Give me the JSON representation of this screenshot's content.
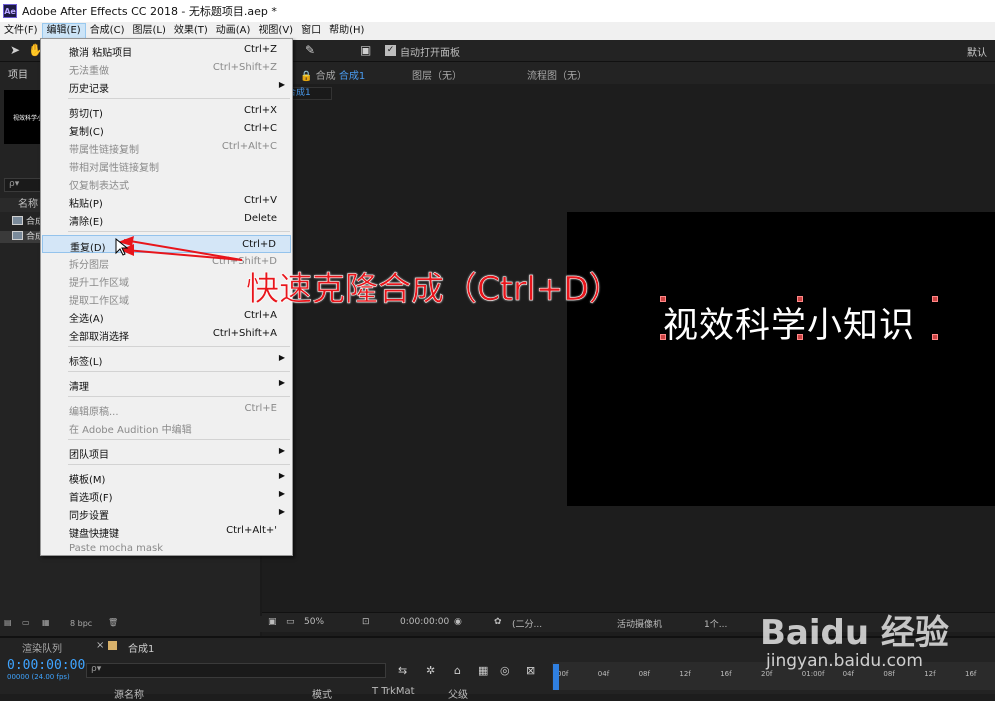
{
  "window": {
    "app_icon": "Ae",
    "title": "Adobe After Effects CC 2018 - 无标题项目.aep *"
  },
  "menubar": [
    "文件(F)",
    "编辑(E)",
    "合成(C)",
    "图层(L)",
    "效果(T)",
    "动画(A)",
    "视图(V)",
    "窗口",
    "帮助(H)"
  ],
  "toolbar": {
    "auto_open_label": "自动打开面板",
    "workspace_label": "默认"
  },
  "project_panel": {
    "tab_label": "项目",
    "thumb_text": "视效科学小知识",
    "search_placeholder": "ρ▾",
    "name_header": "名称",
    "rows": [
      "合成1",
      "合成1"
    ],
    "bpc": "8 bpc"
  },
  "comp_panel": {
    "tab_comp": "合成",
    "tab_comp_name": "合成1",
    "tab_layer": "图层（无）",
    "tab_flow": "流程图（无）",
    "sub_tab": "合成1",
    "canvas_text": "视效科学小知识",
    "zoom": "50%",
    "timecode": "0:00:00:00",
    "resolution": "(二分...",
    "camera": "活动摄像机",
    "views": "1个..."
  },
  "edit_menu": {
    "items": [
      {
        "label": "撤消 粘贴项目",
        "shortcut": "Ctrl+Z",
        "disabled": false
      },
      {
        "label": "无法重做",
        "shortcut": "Ctrl+Shift+Z",
        "disabled": true
      },
      {
        "label": "历史记录",
        "shortcut": "",
        "submenu": true,
        "disabled": false
      },
      {
        "label": "剪切(T)",
        "shortcut": "Ctrl+X",
        "disabled": false
      },
      {
        "label": "复制(C)",
        "shortcut": "Ctrl+C",
        "disabled": false
      },
      {
        "label": "带属性链接复制",
        "shortcut": "Ctrl+Alt+C",
        "disabled": true
      },
      {
        "label": "带相对属性链接复制",
        "shortcut": "",
        "disabled": true
      },
      {
        "label": "仅复制表达式",
        "shortcut": "",
        "disabled": true
      },
      {
        "label": "粘贴(P)",
        "shortcut": "Ctrl+V",
        "disabled": false
      },
      {
        "label": "清除(E)",
        "shortcut": "Delete",
        "disabled": false
      },
      {
        "label": "重复(D)",
        "shortcut": "Ctrl+D",
        "disabled": false,
        "highlighted": true
      },
      {
        "label": "拆分图层",
        "shortcut": "Ctrl+Shift+D",
        "disabled": true
      },
      {
        "label": "提升工作区域",
        "shortcut": "",
        "disabled": true
      },
      {
        "label": "提取工作区域",
        "shortcut": "",
        "disabled": true
      },
      {
        "label": "全选(A)",
        "shortcut": "Ctrl+A",
        "disabled": false
      },
      {
        "label": "全部取消选择",
        "shortcut": "Ctrl+Shift+A",
        "disabled": false
      },
      {
        "label": "标签(L)",
        "shortcut": "",
        "submenu": true,
        "disabled": false
      },
      {
        "label": "清理",
        "shortcut": "",
        "submenu": true,
        "disabled": false
      },
      {
        "label": "编辑原稿...",
        "shortcut": "Ctrl+E",
        "disabled": true
      },
      {
        "label": "在 Adobe Audition 中编辑",
        "shortcut": "",
        "disabled": true
      },
      {
        "label": "团队项目",
        "shortcut": "",
        "submenu": true,
        "disabled": false
      },
      {
        "label": "模板(M)",
        "shortcut": "",
        "submenu": true,
        "disabled": false
      },
      {
        "label": "首选项(F)",
        "shortcut": "",
        "submenu": true,
        "disabled": false
      },
      {
        "label": "同步设置",
        "shortcut": "",
        "submenu": true,
        "disabled": false
      },
      {
        "label": "键盘快捷键",
        "shortcut": "Ctrl+Alt+'",
        "disabled": false
      },
      {
        "label": "Paste mocha mask",
        "shortcut": "",
        "disabled": true
      }
    ]
  },
  "annotation": "快速克隆合成（Ctrl+D）",
  "timeline": {
    "render_queue_tab": "渲染队列",
    "comp_tab": "合成1",
    "timecode": "0:00:00:00",
    "fps": "00000 (24.00 fps)",
    "search_placeholder": "ρ▾",
    "col_source": "源名称",
    "col_mode": "模式",
    "col_trkmat": "T TrkMat",
    "col_parent": "父级",
    "ruler_ticks": [
      "00f",
      "04f",
      "08f",
      "12f",
      "16f",
      "20f",
      "01:00f",
      "04f",
      "08f",
      "12f",
      "16f",
      "20f"
    ]
  },
  "watermark": {
    "brand": "Baidu 经验",
    "url": "jingyan.baidu.com"
  }
}
